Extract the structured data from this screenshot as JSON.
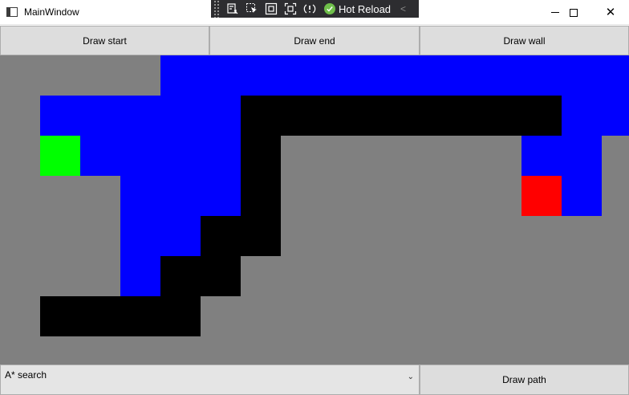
{
  "window": {
    "title": "MainWindow",
    "controls": {
      "minimize": "—",
      "maximize": "☐",
      "close": "✕"
    }
  },
  "xaml_toolbar": {
    "hot_reload_label": "Hot Reload",
    "icons": [
      "live-visual-tree-icon",
      "select-element-icon",
      "display-layout-adorners-icon",
      "track-focus-icon",
      "binding-failures-icon",
      "hot-reload-check-icon"
    ]
  },
  "toolbar": {
    "draw_start": "Draw start",
    "draw_end": "Draw end",
    "draw_wall": "Draw wall"
  },
  "grid": {
    "cols": 16,
    "rows": 8,
    "colors": {
      "empty": "#808080",
      "wall": "#000000",
      "path": "#0000ff",
      "start": "#00ff00",
      "end": "#ff0000"
    },
    "walls": [
      [
        6,
        1
      ],
      [
        7,
        1
      ],
      [
        8,
        1
      ],
      [
        9,
        1
      ],
      [
        10,
        1
      ],
      [
        11,
        1
      ],
      [
        12,
        1
      ],
      [
        13,
        1
      ],
      [
        6,
        2
      ],
      [
        6,
        3
      ],
      [
        5,
        4
      ],
      [
        6,
        4
      ],
      [
        4,
        5
      ],
      [
        5,
        5
      ],
      [
        1,
        6
      ],
      [
        2,
        6
      ],
      [
        3,
        6
      ],
      [
        4,
        6
      ]
    ],
    "path": [
      [
        4,
        0
      ],
      [
        5,
        0
      ],
      [
        6,
        0
      ],
      [
        7,
        0
      ],
      [
        8,
        0
      ],
      [
        9,
        0
      ],
      [
        10,
        0
      ],
      [
        11,
        0
      ],
      [
        12,
        0
      ],
      [
        13,
        0
      ],
      [
        14,
        0
      ],
      [
        15,
        0
      ],
      [
        1,
        1
      ],
      [
        2,
        1
      ],
      [
        3,
        1
      ],
      [
        4,
        1
      ],
      [
        5,
        1
      ],
      [
        14,
        1
      ],
      [
        15,
        1
      ],
      [
        2,
        2
      ],
      [
        3,
        2
      ],
      [
        4,
        2
      ],
      [
        5,
        2
      ],
      [
        13,
        2
      ],
      [
        14,
        2
      ],
      [
        3,
        3
      ],
      [
        4,
        3
      ],
      [
        5,
        3
      ],
      [
        14,
        3
      ],
      [
        3,
        4
      ],
      [
        4,
        4
      ],
      [
        3,
        5
      ]
    ],
    "start": [
      1,
      2
    ],
    "end": [
      13,
      3
    ]
  },
  "bottom": {
    "algorithm_selected": "A* search",
    "draw_path": "Draw path"
  }
}
